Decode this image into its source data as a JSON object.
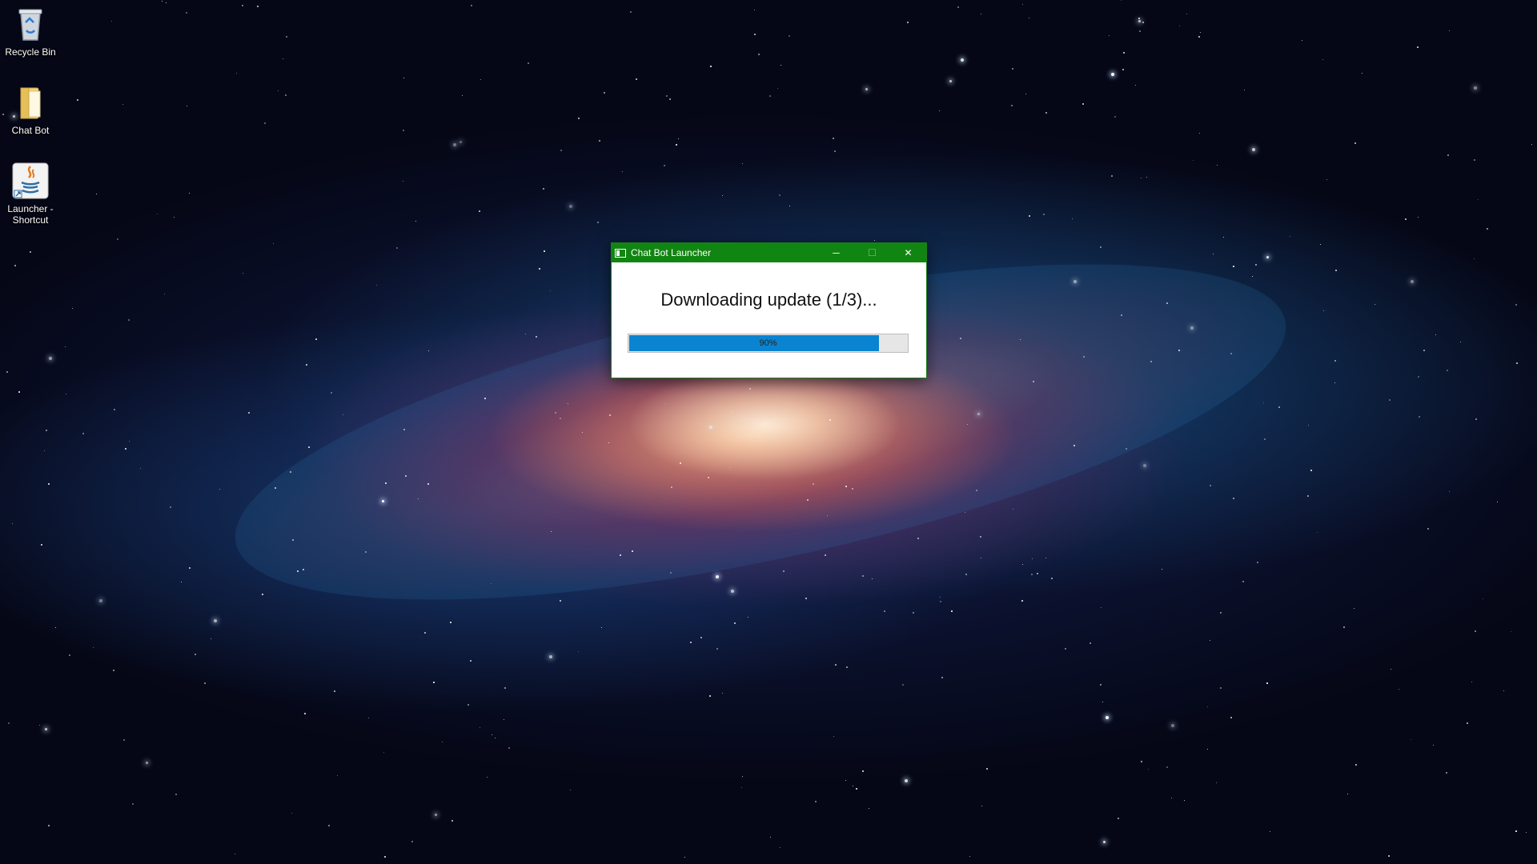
{
  "desktop": {
    "icons": [
      {
        "label": "Recycle Bin",
        "icon": "recycle-bin-icon"
      },
      {
        "label": "Chat Bot",
        "icon": "folder-icon"
      },
      {
        "label": "Launcher - Shortcut",
        "icon": "java-shortcut-icon"
      }
    ]
  },
  "window": {
    "title": "Chat Bot Launcher",
    "app_icon": "window-app-icon",
    "controls": {
      "minimize": "─",
      "maximize": "☐",
      "close": "✕"
    },
    "status": "Downloading update (1/3)...",
    "progress": {
      "percent": 90,
      "label": "90%"
    },
    "titlebar_color": "#118511",
    "progress_color": "#0a84d0"
  }
}
